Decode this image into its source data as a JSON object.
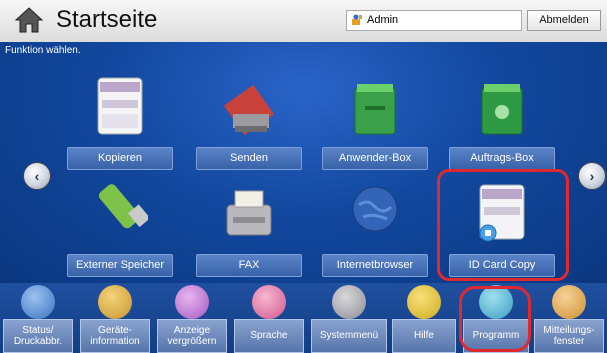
{
  "header": {
    "home_icon": "home-icon",
    "title": "Startseite",
    "user": "Admin",
    "user_icon": "user-icon",
    "logout": "Abmelden"
  },
  "main": {
    "hint": "Funktion wählen.",
    "tiles": [
      {
        "label": "Kopieren",
        "icon": "copier-icon",
        "highlighted": false
      },
      {
        "label": "Senden",
        "icon": "send-icon",
        "highlighted": false
      },
      {
        "label": "Anwender-Box",
        "icon": "user-box-icon",
        "highlighted": false
      },
      {
        "label": "Auftrags-Box",
        "icon": "job-box-icon",
        "highlighted": false
      },
      {
        "label": "Externer Speicher",
        "icon": "usb-memory-icon",
        "highlighted": false
      },
      {
        "label": "FAX",
        "icon": "fax-icon",
        "highlighted": false
      },
      {
        "label": "Internetbrowser",
        "icon": "globe-icon",
        "highlighted": false
      },
      {
        "label": "ID Card Copy",
        "icon": "id-card-copy-icon",
        "highlighted": true
      }
    ],
    "nav_left_icon": "chevron-left-icon",
    "nav_right_icon": "chevron-right-icon"
  },
  "bottom": {
    "items": [
      {
        "label": "Status/ Druckabbr.",
        "icon": "status-icon"
      },
      {
        "label": "Geräte- information",
        "icon": "device-info-icon"
      },
      {
        "label": "Anzeige vergrößern",
        "icon": "magnify-icon"
      },
      {
        "label": "Sprache",
        "icon": "language-icon"
      },
      {
        "label": "Systemmenü",
        "icon": "system-menu-icon"
      },
      {
        "label": "Hilfe",
        "icon": "help-icon"
      },
      {
        "label": "Programm",
        "icon": "program-icon",
        "highlighted": true
      },
      {
        "label": "Mitteilungs- fenster",
        "icon": "message-window-icon"
      }
    ]
  },
  "colors": {
    "highlight": "#e0282f",
    "background": "#12489f"
  }
}
